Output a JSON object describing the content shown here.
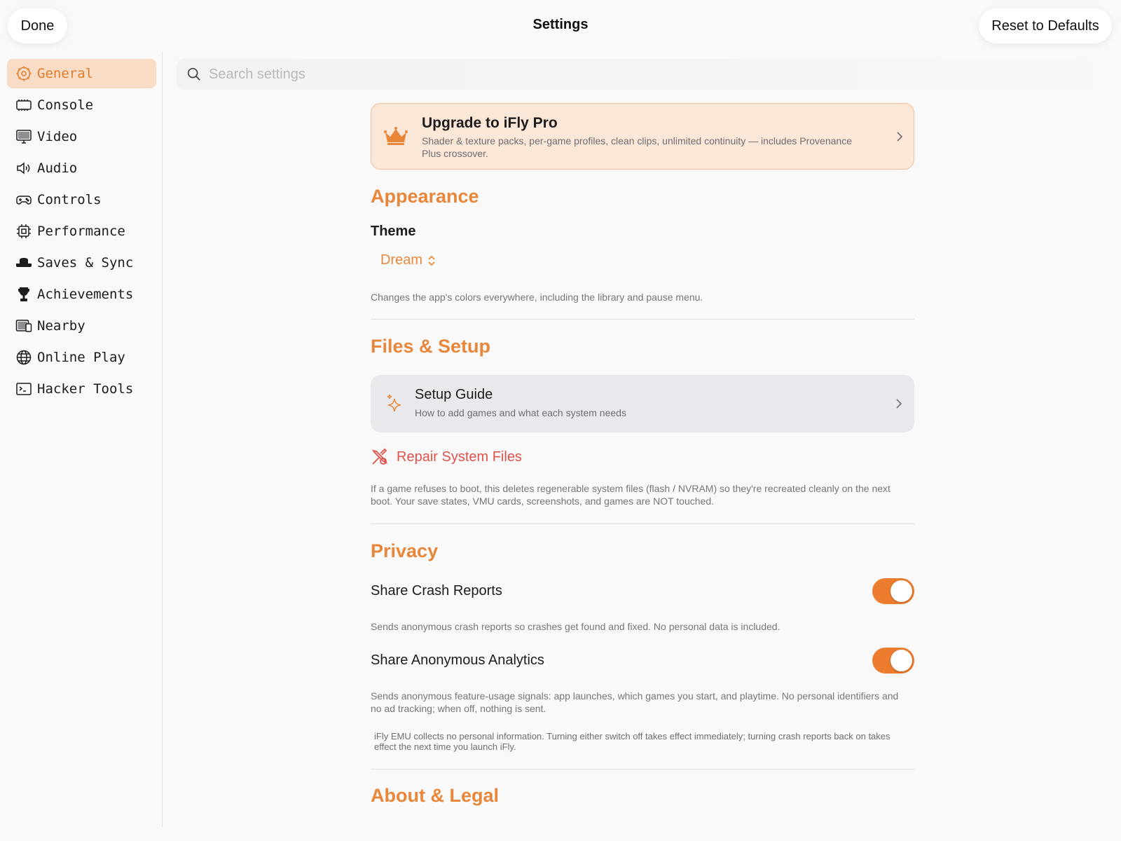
{
  "topbar": {
    "done_label": "Done",
    "title": "Settings",
    "reset_label": "Reset to Defaults"
  },
  "sidebar": {
    "items": [
      {
        "label": "General",
        "icon": "gear-icon",
        "active": true
      },
      {
        "label": "Console",
        "icon": "console-icon",
        "active": false
      },
      {
        "label": "Video",
        "icon": "monitor-icon",
        "active": false
      },
      {
        "label": "Audio",
        "icon": "speaker-icon",
        "active": false
      },
      {
        "label": "Controls",
        "icon": "gamepad-icon",
        "active": false
      },
      {
        "label": "Performance",
        "icon": "cpu-icon",
        "active": false
      },
      {
        "label": "Saves & Sync",
        "icon": "hat-icon",
        "active": false
      },
      {
        "label": "Achievements",
        "icon": "trophy-icon",
        "active": false
      },
      {
        "label": "Nearby",
        "icon": "devices-icon",
        "active": false
      },
      {
        "label": "Online Play",
        "icon": "globe-icon",
        "active": false
      },
      {
        "label": "Hacker Tools",
        "icon": "terminal-icon",
        "active": false
      }
    ]
  },
  "search": {
    "placeholder": "Search settings"
  },
  "pro_banner": {
    "title": "Upgrade to iFly Pro",
    "description": "Shader & texture packs, per-game profiles, clean clips, unlimited continuity — includes Provenance Plus crossover."
  },
  "appearance": {
    "section_title": "Appearance",
    "theme_label": "Theme",
    "theme_value": "Dream",
    "theme_caption": "Changes the app's colors everywhere, including the library and pause menu."
  },
  "files_setup": {
    "section_title": "Files & Setup",
    "setup_guide_title": "Setup Guide",
    "setup_guide_subtitle": "How to add games and what each system needs",
    "repair_label": "Repair System Files",
    "repair_caption": "If a game refuses to boot, this deletes regenerable system files (flash / NVRAM) so they're recreated cleanly on the next boot. Your save states, VMU cards, screenshots, and games are NOT touched."
  },
  "privacy": {
    "section_title": "Privacy",
    "crash_label": "Share Crash Reports",
    "crash_enabled": true,
    "crash_caption": "Sends anonymous crash reports so crashes get found and fixed. No personal data is included.",
    "analytics_label": "Share Anonymous Analytics",
    "analytics_enabled": true,
    "analytics_caption": "Sends anonymous feature-usage signals: app launches, which games you start, and playtime. No personal identifiers and no ad tracking; when off, nothing is sent.",
    "footer_note": "iFly EMU collects no personal information. Turning either switch off takes effect immediately; turning crash reports back on takes effect the next time you launch iFly."
  },
  "about": {
    "section_title": "About & Legal"
  },
  "colors": {
    "accent": "#e8873a",
    "toggle_on": "#ed7d2e",
    "destructive": "#e0524a",
    "active_bg": "#f8dcc6"
  }
}
